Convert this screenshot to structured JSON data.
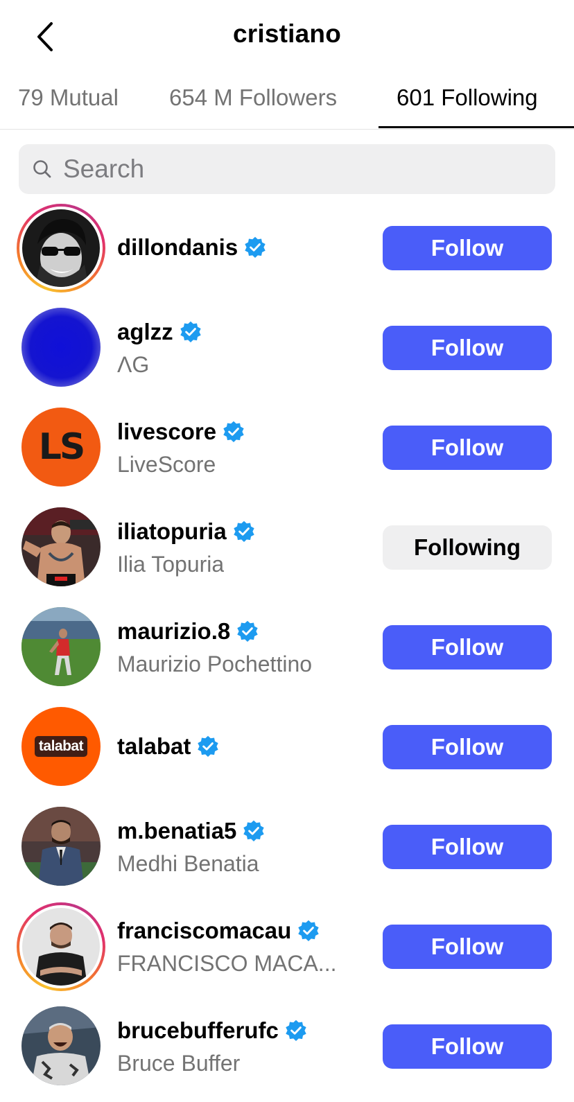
{
  "header": {
    "title": "cristiano",
    "back_icon": "chevron-left-icon"
  },
  "tabs": [
    {
      "label": "79 Mutual",
      "active": false
    },
    {
      "label": "654 M Followers",
      "active": false
    },
    {
      "label": "601 Following",
      "active": true
    }
  ],
  "search": {
    "placeholder": "Search",
    "value": ""
  },
  "accent_color": "#4a5df9",
  "verified_color": "#1d9bf0",
  "accounts": [
    {
      "username": "dillondanis",
      "full_name": "",
      "verified": true,
      "button": "Follow"
    },
    {
      "username": "aglzz",
      "full_name": "ΛG",
      "verified": true,
      "button": "Follow"
    },
    {
      "username": "livescore",
      "full_name": "LiveScore",
      "verified": true,
      "button": "Follow",
      "avatar_text": "LS"
    },
    {
      "username": "iliatopuria",
      "full_name": "Ilia Topuria",
      "verified": true,
      "button": "Following"
    },
    {
      "username": "maurizio.8",
      "full_name": "Maurizio Pochettino",
      "verified": true,
      "button": "Follow"
    },
    {
      "username": "talabat",
      "full_name": "",
      "verified": true,
      "button": "Follow",
      "avatar_text": "talabat"
    },
    {
      "username": "m.benatia5",
      "full_name": "Medhi Benatia",
      "verified": true,
      "button": "Follow"
    },
    {
      "username": "franciscomacau",
      "full_name": "FRANCISCO MACA...",
      "verified": true,
      "button": "Follow"
    },
    {
      "username": "brucebufferufc",
      "full_name": "Bruce Buffer",
      "verified": true,
      "button": "Follow"
    }
  ]
}
